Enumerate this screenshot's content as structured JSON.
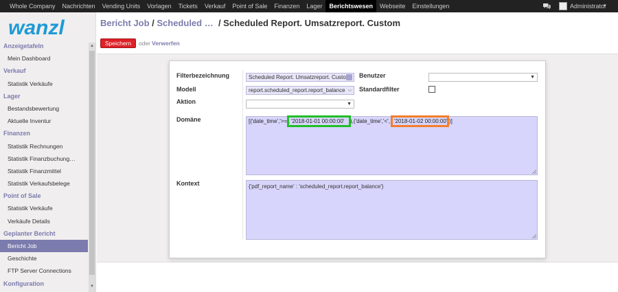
{
  "topnav": {
    "items": [
      "Whole Company",
      "Nachrichten",
      "Vending Units",
      "Vorlagen",
      "Tickets",
      "Verkauf",
      "Point of Sale",
      "Finanzen",
      "Lager",
      "Berichtswesen",
      "Webseite",
      "Einstellungen"
    ],
    "active_index": 9,
    "user_name": "Administrator",
    "chat_icon": "chat-bubbles-icon",
    "caret": "▾"
  },
  "logo": {
    "text": "wanzl",
    "color": "#1d9ad6"
  },
  "sidebar": {
    "sections": [
      {
        "title": "Anzeigetafeln",
        "items": [
          "Mein Dashboard"
        ]
      },
      {
        "title": "Verkauf",
        "items": [
          "Statistik Verkäufe"
        ]
      },
      {
        "title": "Lager",
        "items": [
          "Bestandsbewertung",
          "Aktuelle Inventur"
        ]
      },
      {
        "title": "Finanzen",
        "items": [
          "Statistik Rechnungen",
          "Statistik Finanzbuchung…",
          "Statistik Finanzmittel",
          "Statistik Verkaufsbelege"
        ]
      },
      {
        "title": "Point of Sale",
        "items": [
          "Statistik Verkäufe",
          "Verkäufe Details"
        ]
      },
      {
        "title": "Geplanter Bericht",
        "items": [
          "Bericht Job",
          "Geschichte",
          "FTP Server Connections"
        ]
      },
      {
        "title": "Konfiguration",
        "items": []
      }
    ],
    "active_item": "Bericht Job"
  },
  "breadcrumb": {
    "link1": "Bericht Job",
    "sep1": " / ",
    "link2": "Scheduled …",
    "sep2": "  / ",
    "current": "Scheduled Report. Umsatzreport. Custom"
  },
  "actions": {
    "save_label": "Speichern",
    "or_label": "oder",
    "discard_label": "Verwerfen"
  },
  "form": {
    "filter_name_label": "Filterbezeichnung",
    "filter_name_value": "Scheduled Report. Umsatzreport. Custom",
    "model_label": "Modell",
    "model_value": "report.scheduled_report.report_balance",
    "action_label": "Aktion",
    "action_value": "",
    "user_label": "Benutzer",
    "user_value": "",
    "default_filter_label": "Standardfilter",
    "default_filter_checked": false,
    "domain_label": "Domäne",
    "domain_parts": {
      "prefix": "[('date_time','>=',",
      "value1": "'2018-01-01 00:00:00'",
      "middle": "),('date_time','<',",
      "value2": "'2018-01-02 00:00:00'",
      "suffix": ")]"
    },
    "context_label": "Kontext",
    "context_value": "{'pdf_report_name' : 'scheduled_report.report_balance'}"
  },
  "colors": {
    "accent": "#7c7bad",
    "save_button": "#dc2228",
    "highlight_green": "#1fbf25",
    "highlight_orange": "#f47d2a",
    "textarea_bg": "#d7d5fb"
  }
}
